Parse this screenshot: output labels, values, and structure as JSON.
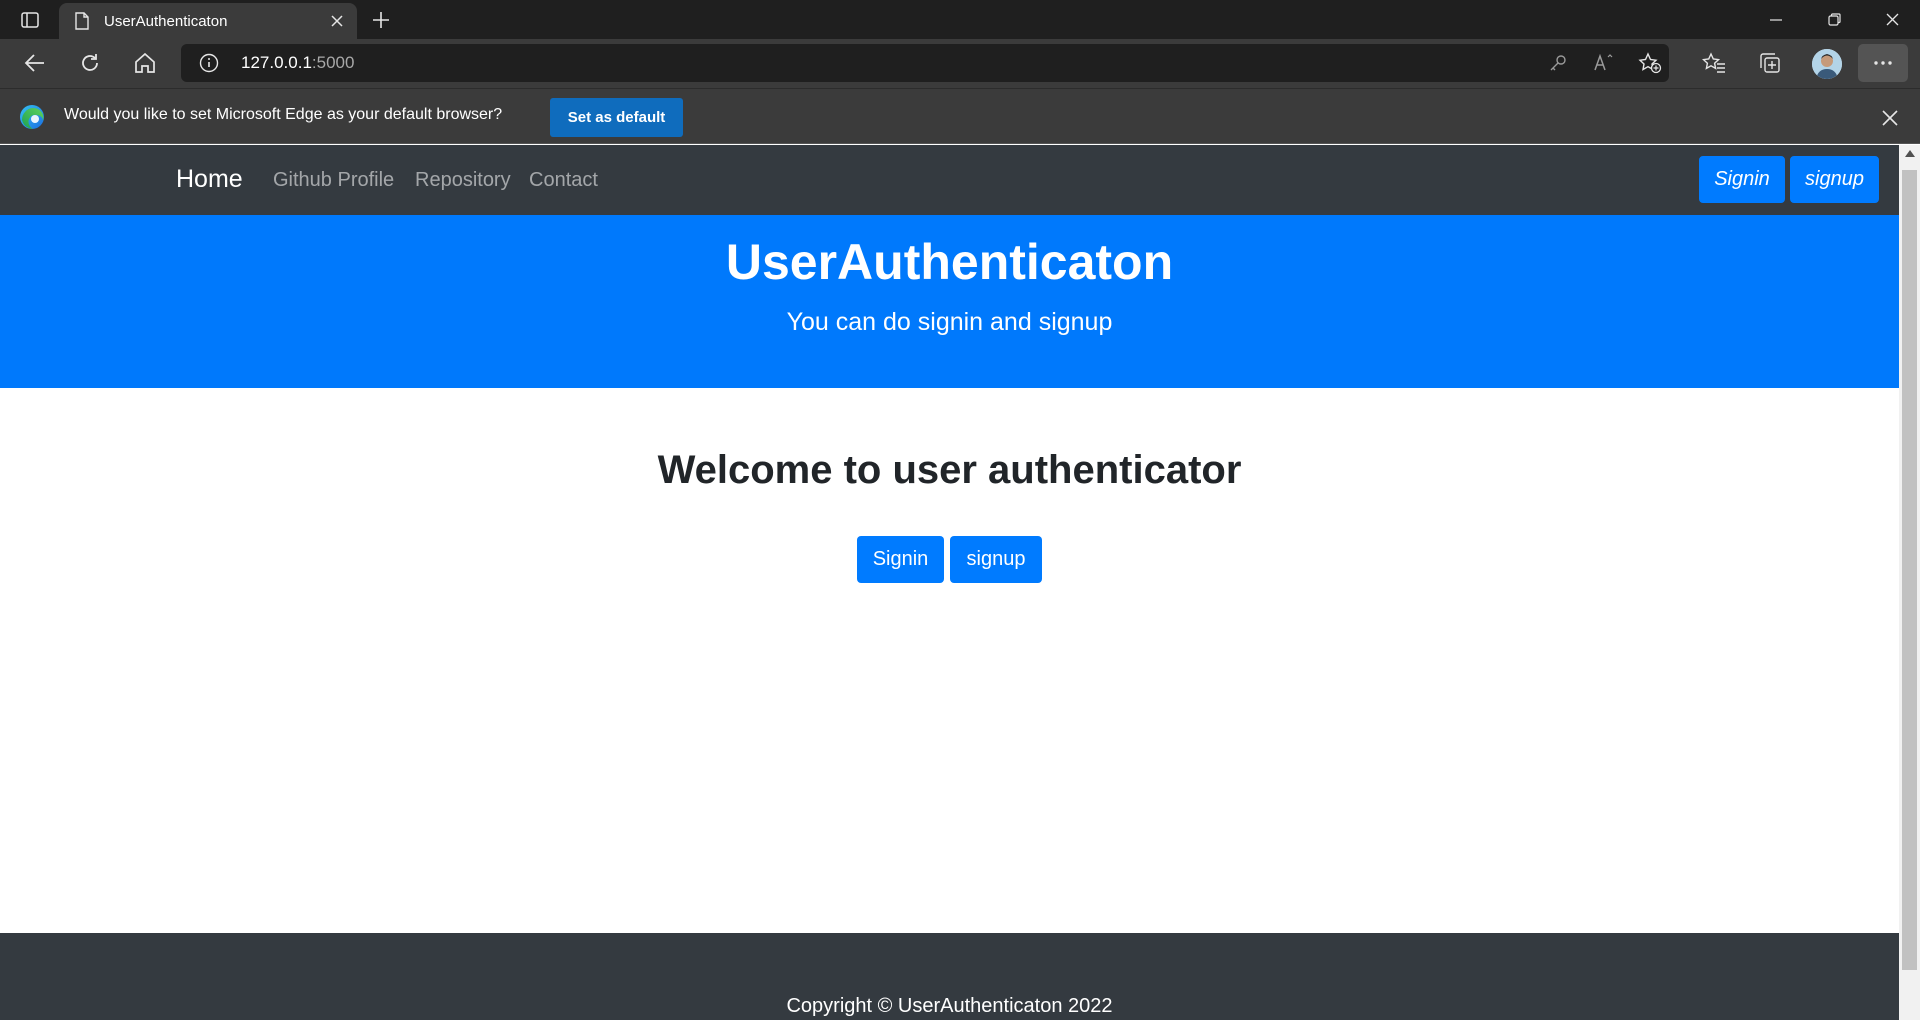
{
  "browser": {
    "tab_title": "UserAuthenticaton",
    "url_host": "127.0.0.1",
    "url_port": ":5000"
  },
  "infobar": {
    "message": "Would you like to set Microsoft Edge as your default browser?",
    "button_label": "Set as default"
  },
  "site": {
    "nav": {
      "brand": "Home",
      "links": [
        "Github Profile",
        "Repository",
        "Contact"
      ],
      "signin_label": "Signin",
      "signup_label": "signup"
    },
    "jumbotron": {
      "title": "UserAuthenticaton",
      "subtitle": "You can do signin and signup"
    },
    "main": {
      "heading": "Welcome to user authenticator",
      "signin_label": "Signin",
      "signup_label": "signup"
    },
    "footer": {
      "copyright": "Copyright © UserAuthenticaton 2022"
    }
  },
  "colors": {
    "primary": "#007bff",
    "navbar": "#343a40",
    "jumbotron": "#0079fc",
    "edge_button": "#0f6cbd"
  },
  "icons": [
    "tab-actions-icon",
    "page-icon",
    "close-icon",
    "plus-icon",
    "minimize-icon",
    "restore-icon",
    "back-arrow-icon",
    "refresh-icon",
    "home-icon",
    "info-icon",
    "key-icon",
    "read-aloud-icon",
    "add-favorite-icon",
    "favorites-icon",
    "collections-icon",
    "more-icon",
    "edge-logo-icon"
  ]
}
